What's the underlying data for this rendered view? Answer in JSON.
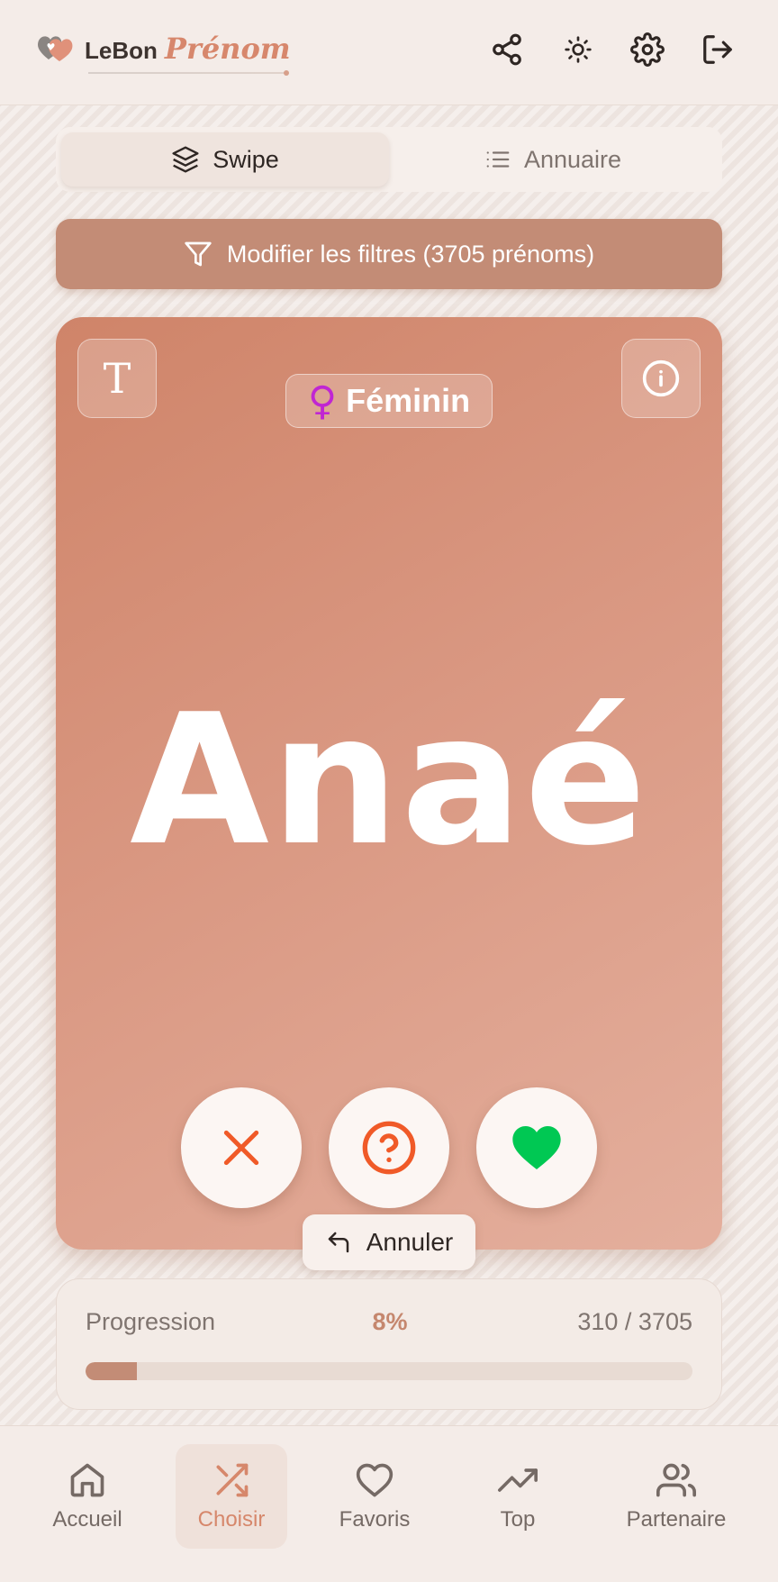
{
  "header": {
    "brand_part1": "LeBon",
    "brand_part2": "Prénom",
    "icons": [
      "share-icon",
      "sun-icon",
      "settings-icon",
      "logout-icon"
    ]
  },
  "tabs": [
    {
      "label": "Swipe",
      "icon": "layers-icon",
      "active": true
    },
    {
      "label": "Annuaire",
      "icon": "list-icon",
      "active": false
    }
  ],
  "filter_button": {
    "label": "Modifier les filtres (3705 prénoms)",
    "icon": "filter-icon"
  },
  "card": {
    "name": "Anaé",
    "gender_symbol": "♀",
    "gender_label": "Féminin",
    "gender_color": "#c026d3",
    "font_button_label": "T",
    "info_icon": "info-icon",
    "actions": [
      {
        "icon": "close-icon",
        "color": "#f05a28"
      },
      {
        "icon": "question-icon",
        "color": "#f05a28"
      },
      {
        "icon": "heart-icon",
        "color": "#00c853"
      }
    ]
  },
  "undo_button": {
    "label": "Annuler",
    "icon": "undo-icon"
  },
  "progress": {
    "label": "Progression",
    "percent_text": "8%",
    "count_text": "310 / 3705",
    "fraction": 0.084
  },
  "nav": [
    {
      "label": "Accueil",
      "icon": "home-icon",
      "active": false
    },
    {
      "label": "Choisir",
      "icon": "shuffle-icon",
      "active": true
    },
    {
      "label": "Favoris",
      "icon": "heart-outline-icon",
      "active": false
    },
    {
      "label": "Top",
      "icon": "trending-icon",
      "active": false
    },
    {
      "label": "Partenaire",
      "icon": "users-icon",
      "active": false
    }
  ],
  "colors": {
    "accent": "#d7876c",
    "card": "#d99781",
    "primary_button": "#c38c76"
  }
}
